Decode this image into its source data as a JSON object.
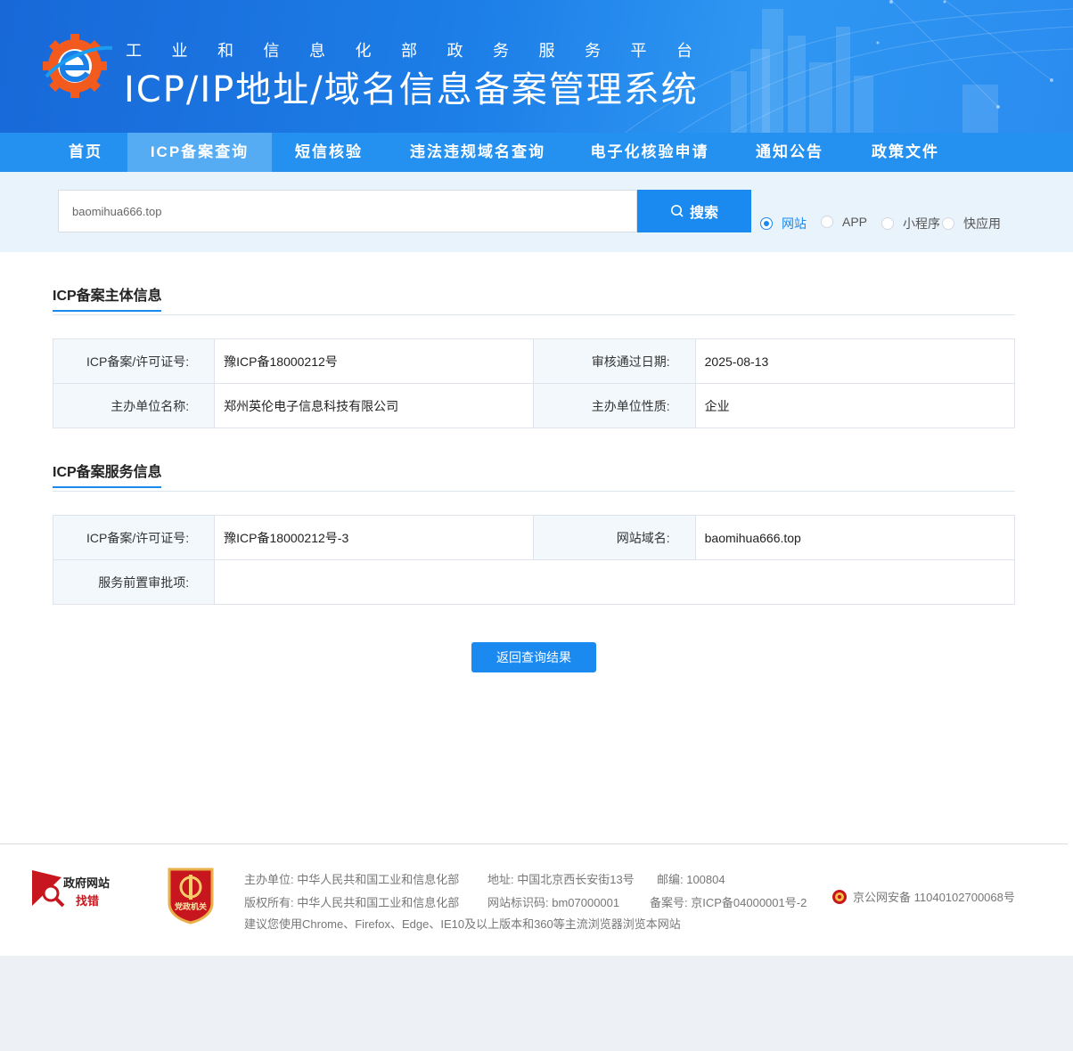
{
  "header": {
    "subtitle": "工业和信息化部政务服务平台",
    "title": "ICP/IP地址/域名信息备案管理系统"
  },
  "nav": {
    "items": [
      {
        "label": "首页"
      },
      {
        "label": "ICP备案查询"
      },
      {
        "label": "短信核验"
      },
      {
        "label": "违法违规域名查询"
      },
      {
        "label": "电子化核验申请"
      },
      {
        "label": "通知公告"
      },
      {
        "label": "政策文件"
      }
    ],
    "active": "ICP备案查询"
  },
  "search": {
    "value": "baomihua666.top",
    "button_label": "搜索",
    "types": [
      {
        "label": "网站",
        "checked": true
      },
      {
        "label": "APP",
        "checked": false
      },
      {
        "label": "小程序",
        "checked": false
      },
      {
        "label": "快应用",
        "checked": false
      }
    ]
  },
  "subject": {
    "title": "ICP备案主体信息",
    "license_label": "ICP备案/许可证号:",
    "license_value": "豫ICP备18000212号",
    "date_label": "审核通过日期:",
    "date_value": "2025-08-13",
    "org_label": "主办单位名称:",
    "org_value": "郑州英伦电子信息科技有限公司",
    "nature_label": "主办单位性质:",
    "nature_value": "企业"
  },
  "service": {
    "title": "ICP备案服务信息",
    "license_label": "ICP备案/许可证号:",
    "license_value": "豫ICP备18000212号-3",
    "domain_label": "网站域名:",
    "domain_value": "baomihua666.top",
    "approval_label": "服务前置审批项:",
    "approval_value": ""
  },
  "back_button": "返回查询结果",
  "footer": {
    "gov_line1": "政府网站",
    "gov_line2": "找错",
    "party_badge": "党政机关",
    "host_unit": "主办单位: 中华人民共和国工业和信息化部",
    "address": "地址: 中国北京西长安街13号",
    "postcode": "邮编: 100804",
    "copyright": "版权所有: 中华人民共和国工业和信息化部",
    "site_id": "网站标识码: bm07000001",
    "icp_no": "备案号: 京ICP备04000001号-2",
    "police_no": "京公网安备 11040102700068号",
    "browser_tip": "建议您使用Chrome、Firefox、Edge、IE10及以上版本和360等主流浏览器浏览本网站"
  },
  "colors": {
    "brand_blue": "#1a89f0",
    "nav_bg": "#2490ef",
    "nav_active": "#55acf3",
    "label_bg": "#f3f8fc"
  }
}
